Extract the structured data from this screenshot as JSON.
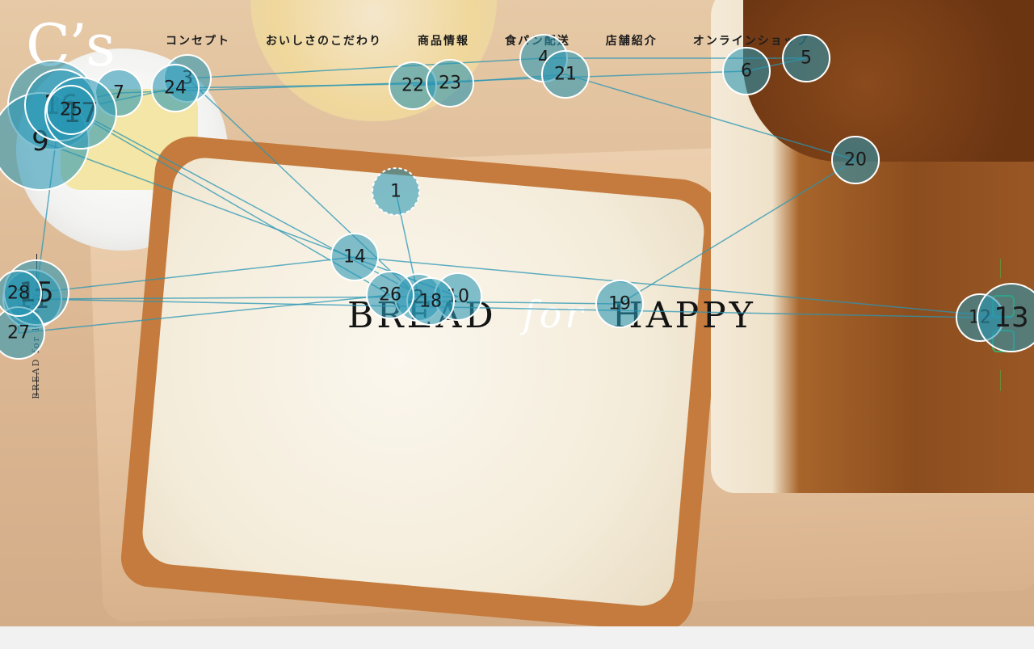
{
  "brand": {
    "logo_text": "C’s"
  },
  "nav": {
    "items": [
      "コンセプト",
      "おいしさのこだわり",
      "商品情報",
      "食パン配送",
      "店舗紹介",
      "オンラインショップ"
    ]
  },
  "hero": {
    "tagline_left": "BREAD",
    "tagline_script": "for",
    "tagline_right": "HAPPY",
    "side_text": "BREAD for HAPPY"
  },
  "social": {
    "icons": [
      "line-icon",
      "instagram-icon"
    ]
  },
  "colors": {
    "accent": "#2896b4",
    "text": "#141414",
    "footer": "#f1f1f1"
  },
  "fixations": [
    {
      "n": "1"
    },
    {
      "n": "2"
    },
    {
      "n": "3"
    },
    {
      "n": "4"
    },
    {
      "n": "5"
    },
    {
      "n": "6"
    },
    {
      "n": "7"
    },
    {
      "n": "8"
    },
    {
      "n": "9"
    },
    {
      "n": "10"
    },
    {
      "n": "11"
    },
    {
      "n": "12"
    },
    {
      "n": "13"
    },
    {
      "n": "14"
    },
    {
      "n": "15"
    },
    {
      "n": "16"
    },
    {
      "n": "17"
    },
    {
      "n": "18"
    },
    {
      "n": "19"
    },
    {
      "n": "20"
    },
    {
      "n": "21"
    },
    {
      "n": "22"
    },
    {
      "n": "23"
    },
    {
      "n": "24"
    },
    {
      "n": "25"
    },
    {
      "n": "26"
    },
    {
      "n": "27"
    },
    {
      "n": "28"
    }
  ]
}
